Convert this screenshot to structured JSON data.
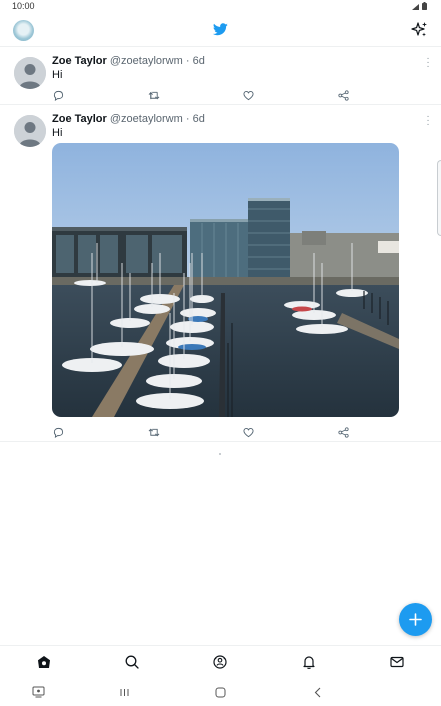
{
  "status_bar": {
    "time": "10:00"
  },
  "tweets": [
    {
      "name": "Zoe Taylor",
      "handle": "@zoetaylorwm",
      "separator": "·",
      "age": "6d",
      "text": "Hi"
    },
    {
      "name": "Zoe Taylor",
      "handle": "@zoetaylorwm",
      "separator": "·",
      "age": "6d",
      "text": "Hi"
    }
  ],
  "icons": {
    "top_left": "profile-avatar",
    "top_center": "twitter-bird-icon",
    "top_right": "sparkle-icon",
    "tweet_actions": [
      "reply-icon",
      "retweet-icon",
      "like-icon",
      "share-icon"
    ],
    "bottom_nav": [
      "home-icon",
      "search-icon",
      "spaces-icon",
      "notifications-icon",
      "messages-icon"
    ],
    "system_nav": [
      "recent-apps-icon",
      "home-button-icon",
      "back-icon"
    ],
    "fab": "plus-icon"
  },
  "colors": {
    "accent": "#1d9bf0",
    "text": "#0f1419",
    "secondary": "#5b6670"
  }
}
